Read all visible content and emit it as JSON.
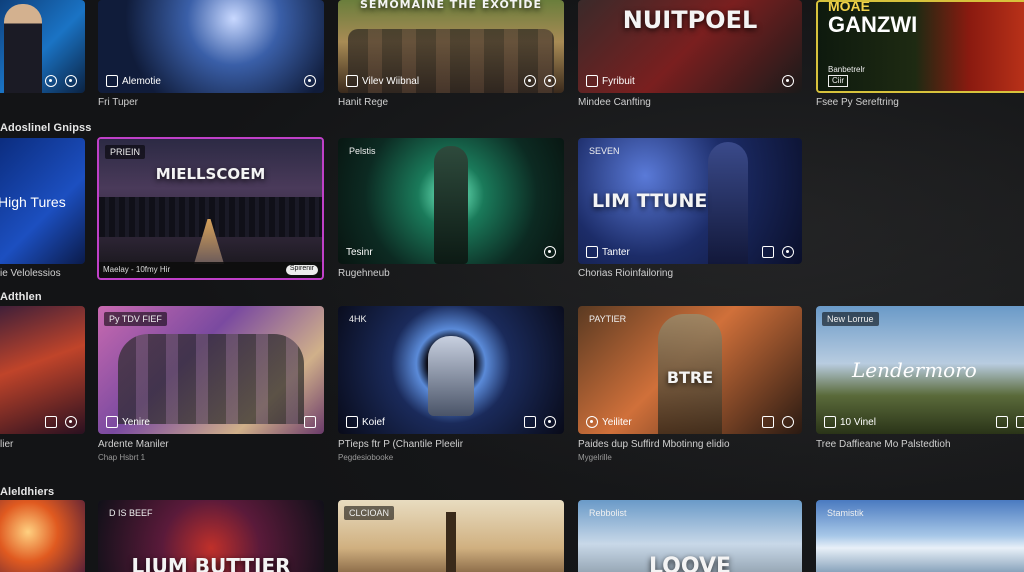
{
  "rows": [
    {
      "label": "",
      "tiles": [
        {
          "chip": "",
          "big": "",
          "bottom": "",
          "caption": ""
        },
        {
          "chip": "",
          "big": "",
          "bottom": "Alemotie",
          "caption": "Fri Tuper"
        },
        {
          "chip": "",
          "big": "SEMOMAINE THE EXOTIDE",
          "bottom": "Vilev Wiibnal",
          "caption": "Hanit Rege"
        },
        {
          "chip": "",
          "big": "NUITPOEL",
          "bottom": "Fyribuit",
          "caption": "Mindee Canfting"
        },
        {
          "chip": "",
          "big": "GANZWI",
          "top_small": "MOAE",
          "bottom": "Banbetrelr",
          "bottom2": "Ciir",
          "caption": "Fsee Py Sereftring"
        }
      ]
    },
    {
      "label": "Adoslinel Gnipss",
      "tiles": [
        {
          "chip": "",
          "big": "High Tures",
          "caption": "ie Velolessios"
        },
        {
          "chip": "PRIEIN",
          "big": "MIELLSCOEM",
          "bar_left": "Maelay - 10fmy Hir",
          "bar_tag": "Spirenir",
          "caption": ""
        },
        {
          "chip": "Pelstis",
          "big": "",
          "bottom": "Tesinr",
          "caption": "Rugehneub"
        },
        {
          "chip": "SEVEN",
          "big": "LIM TTUNE",
          "bottom": "Tanter",
          "caption": "Chorias Rioinfailoring"
        }
      ]
    },
    {
      "label": "Adthlen",
      "tiles": [
        {
          "chip": "",
          "big": "",
          "caption": "lier"
        },
        {
          "chip": "Py TDV FIEF",
          "big": "",
          "bottom": "Yenire",
          "caption": "Ardente Maniler",
          "sub": "Chap Hsbrt 1"
        },
        {
          "chip": "4HK",
          "big": "",
          "bottom": "Koief",
          "caption": "PTieps ftr P (Chantile Pleelir",
          "sub": "Pegdesiobooke"
        },
        {
          "chip": "PAYTIER",
          "big": "BTRE",
          "bottom": "Yeiliter",
          "caption": "Paides dup Suffird Mbotinng elidio",
          "sub": "Mygelrille"
        },
        {
          "chip": "New Lorrue",
          "big": "Lendermoro",
          "bottom": "10 Vinel",
          "caption": "Tree Daffieane Mo Palstedtioh"
        }
      ]
    },
    {
      "label": "Aleldhiers",
      "tiles": [
        {
          "chip": "",
          "big": ""
        },
        {
          "chip": "D IS BEEF",
          "big": "LIUM BUTTIER"
        },
        {
          "chip": "CLCIOAN",
          "big": ""
        },
        {
          "chip": "Rebbolist",
          "big": "LOOVE"
        },
        {
          "chip": "Stamistik",
          "big": ""
        }
      ]
    }
  ]
}
